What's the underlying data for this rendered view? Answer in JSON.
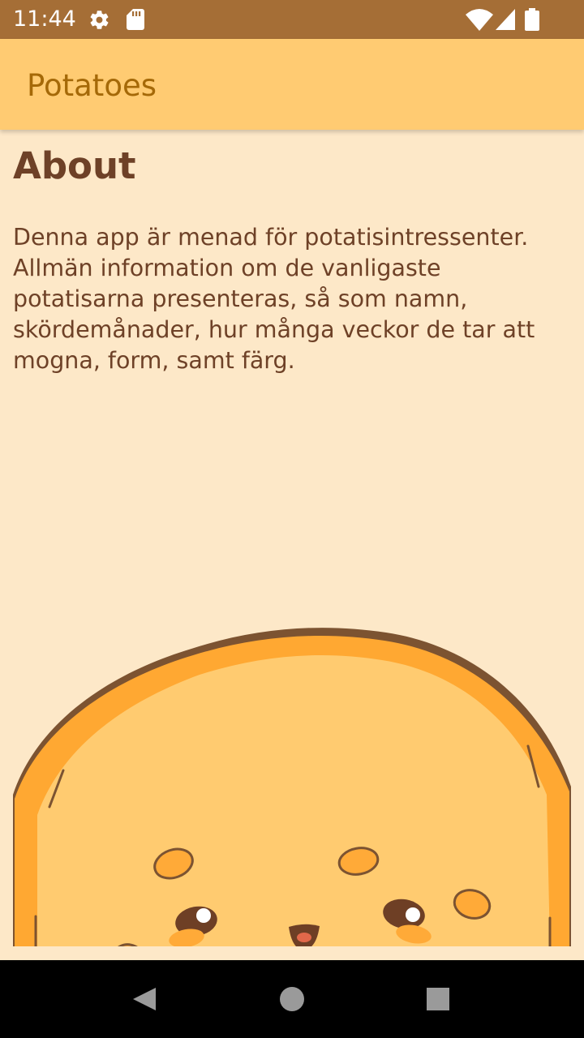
{
  "status_bar": {
    "time": "11:44",
    "icons": [
      "gear-icon",
      "sd-card-icon",
      "wifi-icon",
      "cell-signal-icon",
      "battery-icon"
    ]
  },
  "app_bar": {
    "title": "Potatoes"
  },
  "about": {
    "heading": "About",
    "text": "Denna app är menad för potatisintressenter. Allmän information om de vanligaste potatisarna presenteras, så som namn, skördemånader, hur många veckor de tar att mogna, form, samt färg."
  },
  "illustration": {
    "name": "potato-illustration",
    "colors": {
      "outline": "#7c5331",
      "rim": "#ffa832",
      "flesh": "#ffcb70",
      "spots": "#ffaa38",
      "eyes": "#6e3f25"
    }
  },
  "nav_bar": {
    "buttons": [
      "back-icon",
      "home-icon",
      "recents-icon"
    ]
  },
  "colors": {
    "status_bar": "#a56e36",
    "app_bar": "#ffcb72",
    "title_text": "#a56908",
    "background": "#fde8c8",
    "body_text": "#6e4127"
  }
}
